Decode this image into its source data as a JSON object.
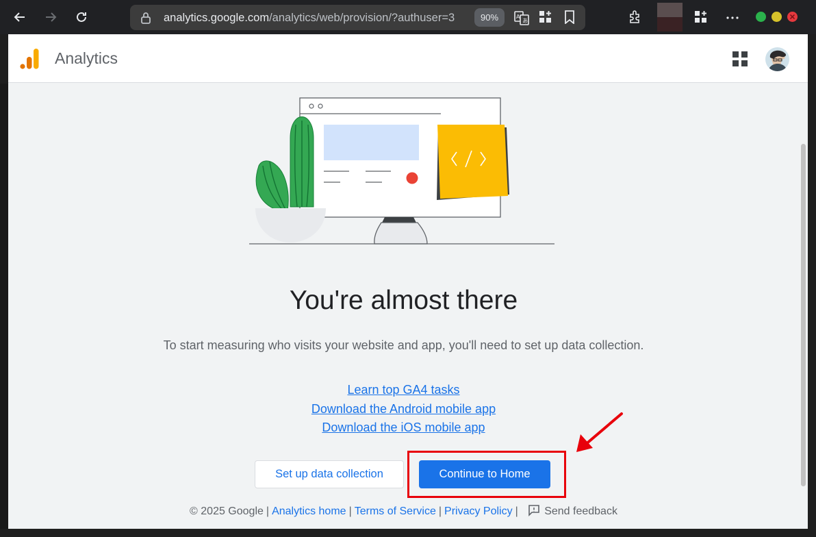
{
  "browser": {
    "url_host": "analytics.google.com",
    "url_path": "/analytics/web/provision/?authuser=3",
    "zoom": "90%",
    "icons": [
      "back-icon",
      "forward-icon",
      "reload-icon",
      "lock-icon",
      "translate-icon",
      "apps-add-icon",
      "bookmark-icon",
      "extensions-icon",
      "collections-icon",
      "more-icon"
    ],
    "window_colors": {
      "minimize": "#2bb24c",
      "maximize": "#d6c22b",
      "close": "#e5393e"
    }
  },
  "appbar": {
    "title": "Analytics",
    "icons": [
      "analytics-logo",
      "google-apps-icon",
      "avatar"
    ]
  },
  "main": {
    "headline": "You're almost there",
    "subtext": "To start measuring who visits your website and app, you'll need to set up data collection.",
    "links": [
      "Learn top GA4 tasks",
      "Download the Android mobile app",
      "Download the iOS mobile app"
    ],
    "secondary_button": "Set up data collection",
    "primary_button": "Continue to Home"
  },
  "footer": {
    "copyright": "© 2025 Google",
    "links": [
      "Analytics home",
      "Terms of Service",
      "Privacy Policy"
    ],
    "feedback": "Send feedback"
  },
  "colors": {
    "accent": "#1a73e8",
    "annotation": "#e8000b"
  }
}
